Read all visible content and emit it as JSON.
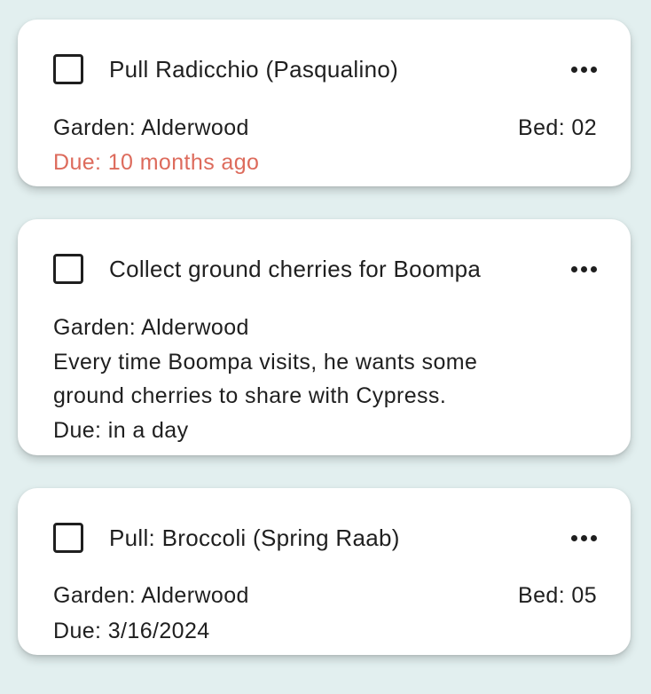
{
  "colors": {
    "background": "#e2efef",
    "card": "#ffffff",
    "text": "#1f1f1f",
    "overdue": "#dd6b5c"
  },
  "tasks": [
    {
      "title": "Pull Radicchio (Pasqualino)",
      "checked": false,
      "garden": "Garden: Alderwood",
      "bed": "Bed: 02",
      "due": "Due: 10 months ago",
      "overdue": true,
      "menu_icon": "more-horizontal-icon"
    },
    {
      "title": "Collect ground cherries for Boompa",
      "checked": false,
      "garden": "Garden: Alderwood",
      "notes": [
        "Every time Boompa visits, he wants some",
        "ground cherries to share with Cypress."
      ],
      "due": "Due: in a day",
      "overdue": false,
      "menu_icon": "more-horizontal-icon"
    },
    {
      "title": "Pull: Broccoli (Spring Raab)",
      "checked": false,
      "garden": "Garden: Alderwood",
      "bed": "Bed: 05",
      "due": "Due: 3/16/2024",
      "overdue": false,
      "menu_icon": "more-horizontal-icon"
    }
  ]
}
